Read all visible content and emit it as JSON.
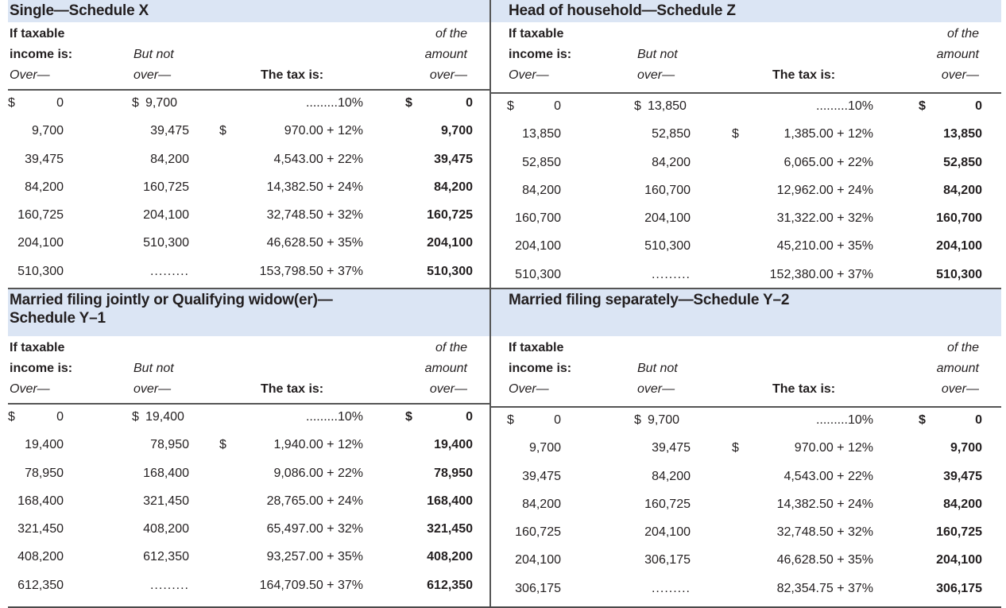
{
  "column_headers": {
    "over_line1": "If taxable",
    "over_line2": "income is:",
    "over_line3": "Over—",
    "butnot_line1": "But not",
    "butnot_line2": "over—",
    "tax_is": "The tax is:",
    "ofthe_line1": "of the",
    "ofthe_line2": "amount",
    "ofthe_line3": "over—"
  },
  "schedules": [
    {
      "title": "Single—Schedule X",
      "rows": [
        {
          "over_sign": "$",
          "over": "0",
          "butnot_sign": "$",
          "butnot": "9,700",
          "tax_sign": "",
          "tax": ".........10%",
          "amt_sign": "$",
          "amt": "0"
        },
        {
          "over_sign": "",
          "over": "9,700",
          "butnot_sign": "",
          "butnot": "39,475",
          "tax_sign": "$",
          "tax": "970.00 + 12%",
          "amt_sign": "",
          "amt": "9,700"
        },
        {
          "over_sign": "",
          "over": "39,475",
          "butnot_sign": "",
          "butnot": "84,200",
          "tax_sign": "",
          "tax": "4,543.00 + 22%",
          "amt_sign": "",
          "amt": "39,475"
        },
        {
          "over_sign": "",
          "over": "84,200",
          "butnot_sign": "",
          "butnot": "160,725",
          "tax_sign": "",
          "tax": "14,382.50 + 24%",
          "amt_sign": "",
          "amt": "84,200"
        },
        {
          "over_sign": "",
          "over": "160,725",
          "butnot_sign": "",
          "butnot": "204,100",
          "tax_sign": "",
          "tax": "32,748.50 + 32%",
          "amt_sign": "",
          "amt": "160,725"
        },
        {
          "over_sign": "",
          "over": "204,100",
          "butnot_sign": "",
          "butnot": "510,300",
          "tax_sign": "",
          "tax": "46,628.50 + 35%",
          "amt_sign": "",
          "amt": "204,100"
        },
        {
          "over_sign": "",
          "over": "510,300",
          "butnot_sign": "",
          "butnot": ".........",
          "tax_sign": "",
          "tax": "153,798.50 + 37%",
          "amt_sign": "",
          "amt": "510,300"
        }
      ]
    },
    {
      "title": "Head of household—Schedule Z",
      "rows": [
        {
          "over_sign": "$",
          "over": "0",
          "butnot_sign": "$",
          "butnot": "13,850",
          "tax_sign": "",
          "tax": ".........10%",
          "amt_sign": "$",
          "amt": "0"
        },
        {
          "over_sign": "",
          "over": "13,850",
          "butnot_sign": "",
          "butnot": "52,850",
          "tax_sign": "$",
          "tax": "1,385.00 + 12%",
          "amt_sign": "",
          "amt": "13,850"
        },
        {
          "over_sign": "",
          "over": "52,850",
          "butnot_sign": "",
          "butnot": "84,200",
          "tax_sign": "",
          "tax": "6,065.00 + 22%",
          "amt_sign": "",
          "amt": "52,850"
        },
        {
          "over_sign": "",
          "over": "84,200",
          "butnot_sign": "",
          "butnot": "160,700",
          "tax_sign": "",
          "tax": "12,962.00 + 24%",
          "amt_sign": "",
          "amt": "84,200"
        },
        {
          "over_sign": "",
          "over": "160,700",
          "butnot_sign": "",
          "butnot": "204,100",
          "tax_sign": "",
          "tax": "31,322.00 + 32%",
          "amt_sign": "",
          "amt": "160,700"
        },
        {
          "over_sign": "",
          "over": "204,100",
          "butnot_sign": "",
          "butnot": "510,300",
          "tax_sign": "",
          "tax": "45,210.00 + 35%",
          "amt_sign": "",
          "amt": "204,100"
        },
        {
          "over_sign": "",
          "over": "510,300",
          "butnot_sign": "",
          "butnot": ".........",
          "tax_sign": "",
          "tax": "152,380.00 + 37%",
          "amt_sign": "",
          "amt": "510,300"
        }
      ]
    },
    {
      "title_line1": "Married filing jointly or Qualifying widow(er)—",
      "title_line2": "Schedule Y–1",
      "rows": [
        {
          "over_sign": "$",
          "over": "0",
          "butnot_sign": "$",
          "butnot": "19,400",
          "tax_sign": "",
          "tax": ".........10%",
          "amt_sign": "$",
          "amt": "0"
        },
        {
          "over_sign": "",
          "over": "19,400",
          "butnot_sign": "",
          "butnot": "78,950",
          "tax_sign": "$",
          "tax": "1,940.00 + 12%",
          "amt_sign": "",
          "amt": "19,400"
        },
        {
          "over_sign": "",
          "over": "78,950",
          "butnot_sign": "",
          "butnot": "168,400",
          "tax_sign": "",
          "tax": "9,086.00 + 22%",
          "amt_sign": "",
          "amt": "78,950"
        },
        {
          "over_sign": "",
          "over": "168,400",
          "butnot_sign": "",
          "butnot": "321,450",
          "tax_sign": "",
          "tax": "28,765.00 + 24%",
          "amt_sign": "",
          "amt": "168,400"
        },
        {
          "over_sign": "",
          "over": "321,450",
          "butnot_sign": "",
          "butnot": "408,200",
          "tax_sign": "",
          "tax": "65,497.00 + 32%",
          "amt_sign": "",
          "amt": "321,450"
        },
        {
          "over_sign": "",
          "over": "408,200",
          "butnot_sign": "",
          "butnot": "612,350",
          "tax_sign": "",
          "tax": "93,257.00 + 35%",
          "amt_sign": "",
          "amt": "408,200"
        },
        {
          "over_sign": "",
          "over": "612,350",
          "butnot_sign": "",
          "butnot": ".........",
          "tax_sign": "",
          "tax": "164,709.50 + 37%",
          "amt_sign": "",
          "amt": "612,350"
        }
      ]
    },
    {
      "title": "Married filing separately—Schedule Y–2",
      "rows": [
        {
          "over_sign": "$",
          "over": "0",
          "butnot_sign": "$",
          "butnot": "9,700",
          "tax_sign": "",
          "tax": ".........10%",
          "amt_sign": "$",
          "amt": "0"
        },
        {
          "over_sign": "",
          "over": "9,700",
          "butnot_sign": "",
          "butnot": "39,475",
          "tax_sign": "$",
          "tax": "970.00 + 12%",
          "amt_sign": "",
          "amt": "9,700"
        },
        {
          "over_sign": "",
          "over": "39,475",
          "butnot_sign": "",
          "butnot": "84,200",
          "tax_sign": "",
          "tax": "4,543.00 + 22%",
          "amt_sign": "",
          "amt": "39,475"
        },
        {
          "over_sign": "",
          "over": "84,200",
          "butnot_sign": "",
          "butnot": "160,725",
          "tax_sign": "",
          "tax": "14,382.50 + 24%",
          "amt_sign": "",
          "amt": "84,200"
        },
        {
          "over_sign": "",
          "over": "160,725",
          "butnot_sign": "",
          "butnot": "204,100",
          "tax_sign": "",
          "tax": "32,748.50 + 32%",
          "amt_sign": "",
          "amt": "160,725"
        },
        {
          "over_sign": "",
          "over": "204,100",
          "butnot_sign": "",
          "butnot": "306,175",
          "tax_sign": "",
          "tax": "46,628.50 + 35%",
          "amt_sign": "",
          "amt": "204,100"
        },
        {
          "over_sign": "",
          "over": "306,175",
          "butnot_sign": "",
          "butnot": ".........",
          "tax_sign": "",
          "tax": "82,354.75 + 37%",
          "amt_sign": "",
          "amt": "306,175"
        }
      ]
    }
  ]
}
